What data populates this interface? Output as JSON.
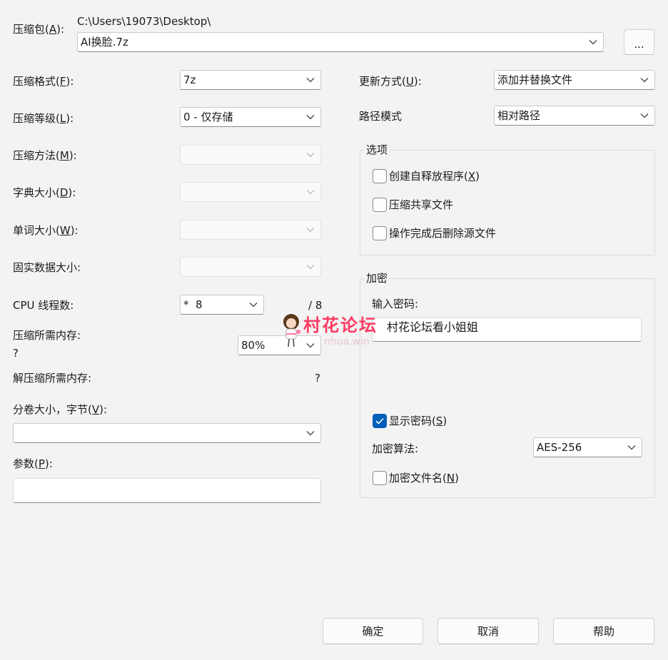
{
  "archive": {
    "label_text": "压缩包(",
    "label_key": "A",
    "label_end": "):",
    "path": "C:\\Users\\19073\\Desktop\\",
    "filename": "AI换脸.7z",
    "browse_label": "..."
  },
  "left": {
    "format": {
      "label": "压缩格式(",
      "key": "F",
      "end": "):",
      "value": "7z"
    },
    "level": {
      "label": "压缩等级(",
      "key": "L",
      "end": "):",
      "value": "0 - 仅存储"
    },
    "method": {
      "label": "压缩方法(",
      "key": "M",
      "end": "):",
      "value": ""
    },
    "dict": {
      "label": "字典大小(",
      "key": "D",
      "end": "):",
      "value": ""
    },
    "word": {
      "label": "单词大小(",
      "key": "W",
      "end": "):",
      "value": ""
    },
    "solid": {
      "label": "固实数据大小:",
      "value": ""
    },
    "cpu": {
      "label": "CPU 线程数:",
      "value": "*  8",
      "max": "/ 8"
    },
    "mem_compress": {
      "label": "压缩所需内存:",
      "value": "?",
      "percent": "80%"
    },
    "mem_decompress": {
      "label": "解压缩所需内存:",
      "value": "?"
    },
    "volume": {
      "label": "分卷大小，字节(",
      "key": "V",
      "end": "):",
      "value": ""
    },
    "params": {
      "label": "参数(",
      "key": "P",
      "end": "):",
      "value": ""
    }
  },
  "right": {
    "update": {
      "label": "更新方式(",
      "key": "U",
      "end": "):",
      "value": "添加并替换文件"
    },
    "path_mode": {
      "label": "路径模式",
      "value": "相对路径"
    },
    "options": {
      "title": "选项",
      "sfx": {
        "label": "创建自释放程序(",
        "key": "X",
        "end": ")",
        "checked": false
      },
      "shared": {
        "label": "压缩共享文件",
        "checked": false
      },
      "delete": {
        "label": "操作完成后删除源文件",
        "checked": false
      }
    },
    "encryption": {
      "title": "加密",
      "password_label": "输入密码:",
      "password_value": "村花论坛看小姐姐",
      "show_password": {
        "label": "显示密码(",
        "key": "S",
        "end": ")",
        "checked": true
      },
      "method_label": "加密算法:",
      "method_value": "AES-256",
      "encrypt_names": {
        "label": "加密文件名(",
        "key": "N",
        "end": ")",
        "checked": false
      }
    }
  },
  "watermark": {
    "title": "村花论坛",
    "sub": "nhua.win"
  },
  "buttons": {
    "ok": "确定",
    "cancel": "取消",
    "help": "帮助"
  },
  "colors": {
    "accent": "#005fb8",
    "watermark": "#ff3b63"
  }
}
